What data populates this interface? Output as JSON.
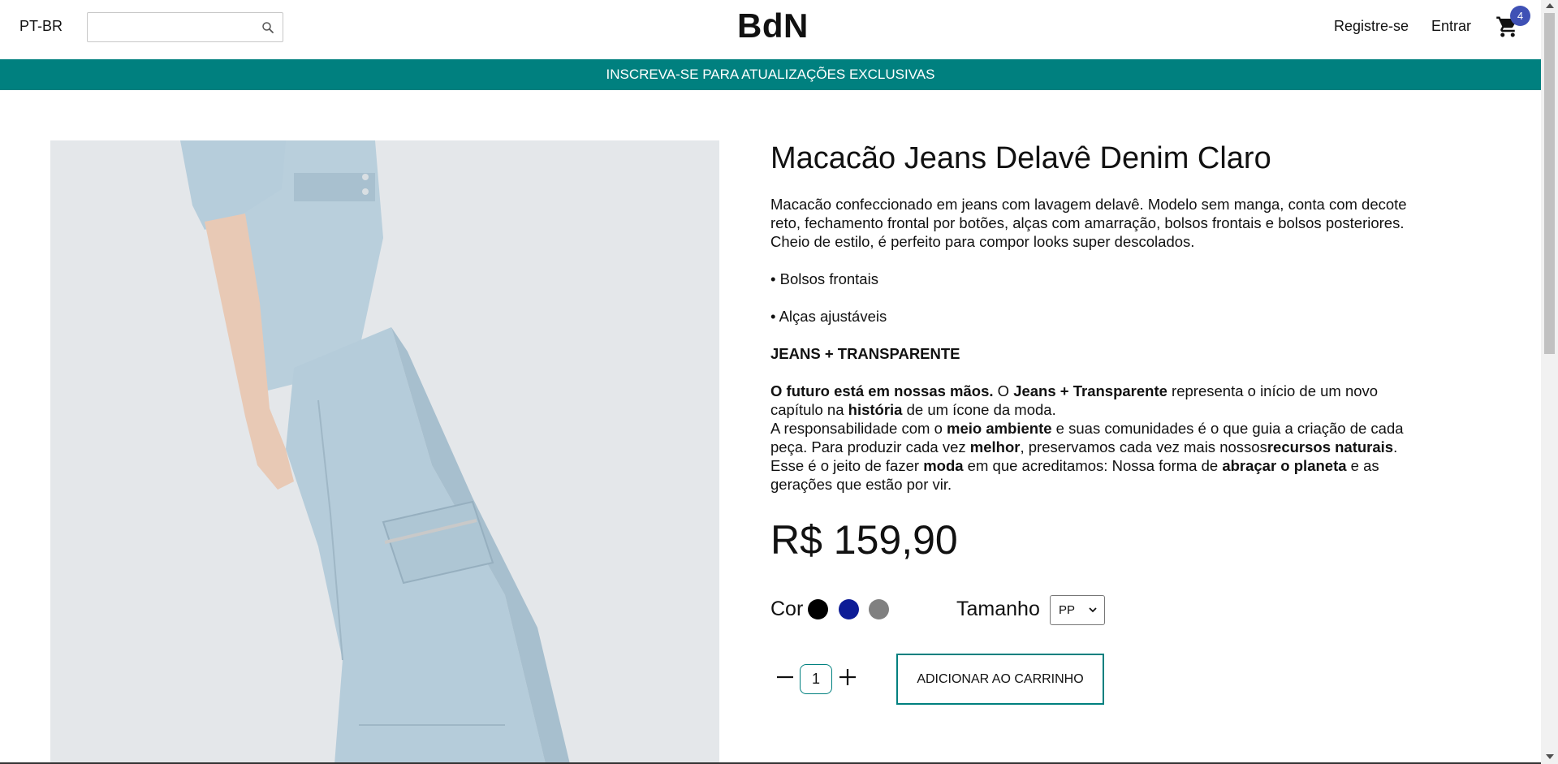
{
  "header": {
    "language": "PT-BR",
    "search_placeholder": "",
    "search_value": "",
    "logo": "BdN",
    "register_label": "Registre-se",
    "login_label": "Entrar",
    "cart_count": "4",
    "cart_icon": "cart-icon",
    "search_icon": "search-icon"
  },
  "banner": {
    "text": "INSCREVA-SE PARA ATUALIZAÇÕES EXCLUSIVAS",
    "color": "#00807f"
  },
  "product": {
    "image_alt": "Macacão Jeans Delavê Denim Claro",
    "title": "Macacão Jeans Delavê Denim Claro",
    "desc_intro": "Macacão confeccionado em jeans com lavagem delavê. Modelo sem manga, conta com decote reto, fechamento frontal por botões, alças com amarração, bolsos frontais e bolsos posteriores. Cheio de estilo, é perfeito para compor looks super descolados.",
    "bullet_1": "• Bolsos frontais",
    "bullet_2": "• Alças ajustáveis",
    "section_heading": "JEANS + TRANSPARENTE",
    "p1_b1": "O futuro está em nossas mãos.",
    "p1_t1": " O ",
    "p1_b2": "Jeans + Transparente",
    "p1_t2": " representa o início de um novo capítulo na ",
    "p1_b3": "história",
    "p1_t3": " de um ícone da moda.",
    "p2_t1": "A responsabilidade com o ",
    "p2_b1": "meio ambiente",
    "p2_t2": " e suas comunidades é o que guia a criação de cada peça. Para produzir cada vez ",
    "p2_b2": "melhor",
    "p2_t3": ", preservamos cada vez mais nossos",
    "p2_b3": "recursos naturais",
    "p2_t4": ". Esse é o jeito de fazer ",
    "p2_b4": "moda",
    "p2_t5": " em que acreditamos: Nossa forma de ",
    "p2_b5": "abraçar o planeta",
    "p2_t6": " e as gerações que estão por vir.",
    "price": "R$ 159,90",
    "color_label": "Cor",
    "colors": [
      "#000000",
      "#0d1c96",
      "#808080"
    ],
    "size_label": "Tamanho",
    "size_selected": "PP",
    "quantity": "1",
    "add_to_cart_label": "ADICIONAR AO CARRINHO",
    "accent": "#00807f"
  }
}
